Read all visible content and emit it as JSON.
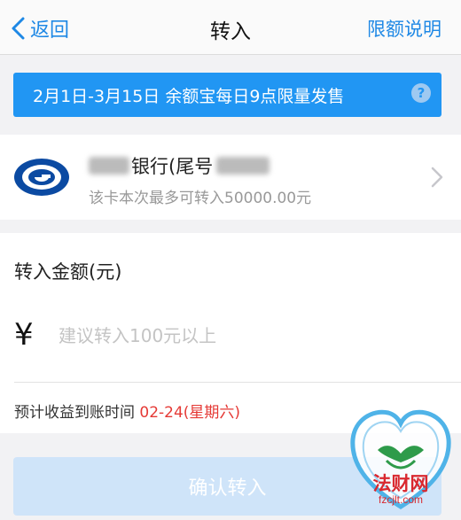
{
  "nav": {
    "back_label": "返回",
    "title": "转入",
    "right_label": "限额说明"
  },
  "banner": {
    "text": "2月1日-3月15日 余额宝每日9点限量发售",
    "help_glyph": "?"
  },
  "bank": {
    "name": "银行(尾号",
    "limit_text": "该卡本次最多可转入50000.00元"
  },
  "amount": {
    "label": "转入金额(元)",
    "currency_symbol": "¥",
    "placeholder": "建议转入100元以上",
    "value": ""
  },
  "eta": {
    "label": "预计收益到账时间",
    "date": "02-24(星期六)"
  },
  "confirm": {
    "label": "确认转入"
  },
  "watermark": {
    "title": "法财网",
    "site": "fzcjlt.com"
  },
  "colors": {
    "accent": "#1e88e5",
    "banner": "#2196f3",
    "highlight": "#e53935",
    "button_disabled": "#cfe4f9"
  }
}
